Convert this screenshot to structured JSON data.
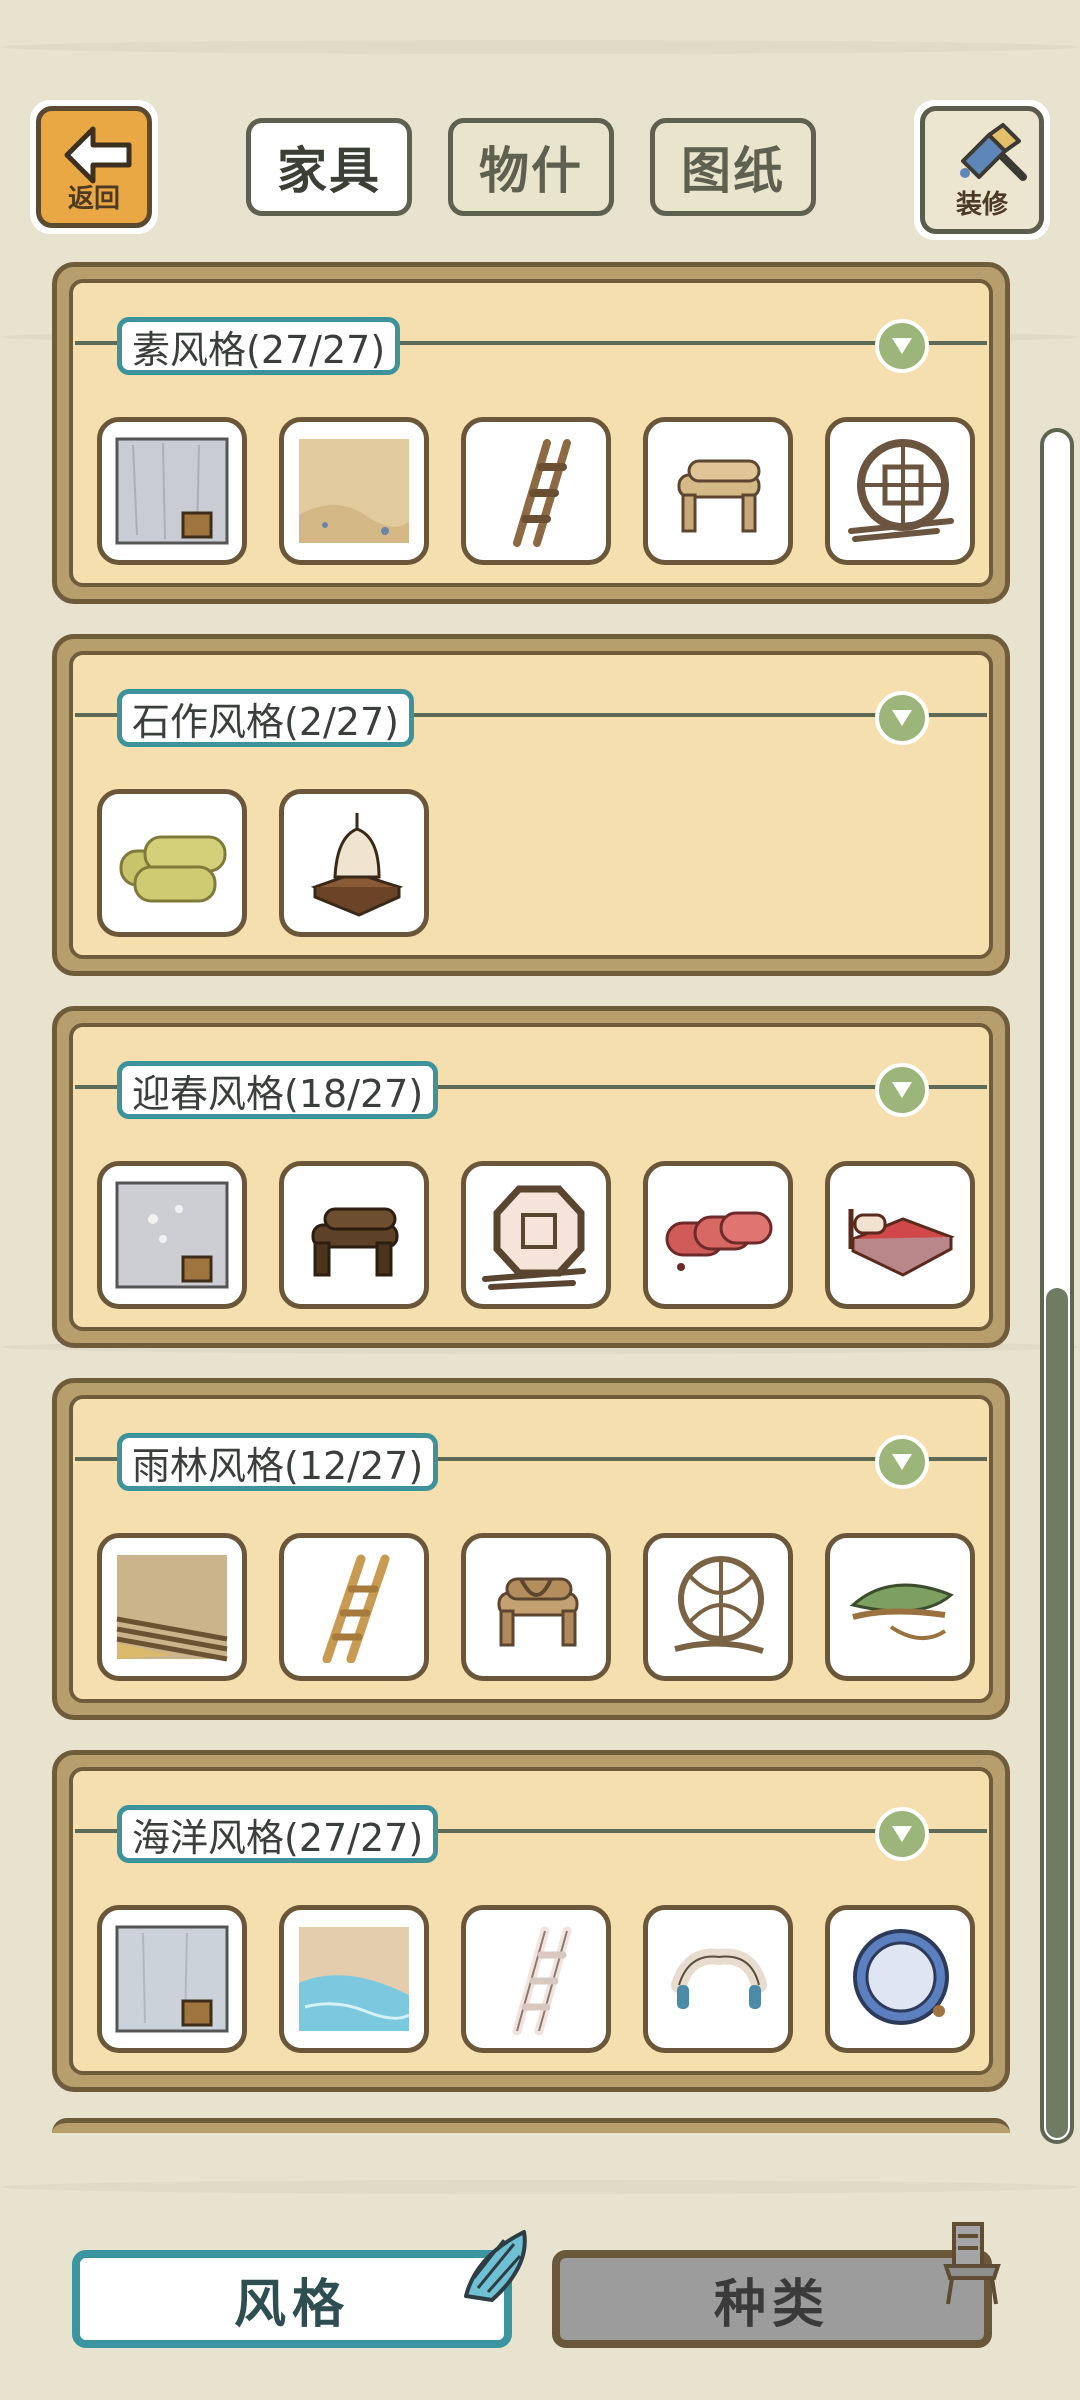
{
  "header": {
    "back_label": "返回",
    "tabs": [
      {
        "label": "家具",
        "active": true
      },
      {
        "label": "物什",
        "active": false
      },
      {
        "label": "图纸",
        "active": false
      }
    ],
    "decorate_label": "装修"
  },
  "panels": [
    {
      "title": "素风格(27/27)",
      "items": [
        "plain-wall-with-bucket",
        "sand-floor",
        "wooden-ladder",
        "log-bench",
        "round-lattice-window"
      ]
    },
    {
      "title": "石作风格(2/27)",
      "items": [
        "straw-rolls",
        "stone-lantern"
      ]
    },
    {
      "title": "迎春风格(18/27)",
      "items": [
        "spring-wall-with-bucket",
        "dark-log-bench",
        "octagon-window",
        "red-rolls",
        "red-bed"
      ]
    },
    {
      "title": "雨林风格(12/27)",
      "items": [
        "rainforest-floor",
        "bamboo-ladder",
        "rope-log-bench",
        "vine-ball-window",
        "leaf-hammock"
      ]
    },
    {
      "title": "海洋风格(27/27)",
      "items": [
        "ocean-wall-with-bucket",
        "ocean-water-floor",
        "white-ladder",
        "coral-bench",
        "porthole-window"
      ]
    }
  ],
  "footer": {
    "style_label": "风格",
    "type_label": "种类"
  },
  "colors": {
    "panel_border": "#6e5c3b",
    "panel_fill": "#f6dfae",
    "title_border": "#3e9299",
    "expand_button": "#9bb57a"
  }
}
